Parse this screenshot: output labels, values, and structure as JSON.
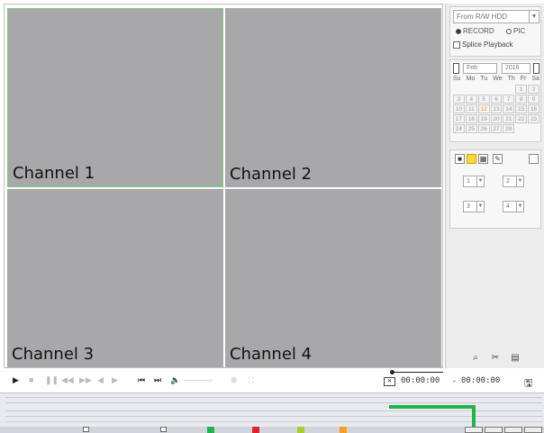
{
  "panes": [
    {
      "label": "Channel 1"
    },
    {
      "label": "Channel 2"
    },
    {
      "label": "Channel 3"
    },
    {
      "label": "Channel 4"
    }
  ],
  "source": {
    "selected": "From R/W HDD",
    "record_label": "RECORD",
    "pic_label": "PIC",
    "splice_label": "Splice Playback"
  },
  "calendar": {
    "month": "Feb",
    "year": "2016",
    "weekdays": [
      "Su",
      "Mo",
      "Tu",
      "We",
      "Th",
      "Fr",
      "Sa"
    ],
    "leading_blanks": 5,
    "days": [
      "1",
      "2",
      "3",
      "4",
      "5",
      "6",
      "7",
      "8",
      "9",
      "10",
      "11",
      "12",
      "13",
      "14",
      "15",
      "16",
      "17",
      "18",
      "19",
      "20",
      "21",
      "22",
      "23",
      "24",
      "25",
      "26",
      "27",
      "28"
    ],
    "today": "12"
  },
  "channel_select": {
    "slot1": "1",
    "slot2": "2",
    "slot3": "3",
    "slot4": "4"
  },
  "playback": {
    "time_start": "00:00:00",
    "time_sep": "-",
    "time_end": "00:00:00"
  },
  "colors": {
    "selected_pane_border": "#6fcf6f",
    "record_bar": "#22b44a",
    "legend_green": "#22b44a",
    "legend_red": "#e0242a",
    "legend_yellowgreen": "#a6cf2a",
    "legend_orange": "#f2a21e"
  }
}
